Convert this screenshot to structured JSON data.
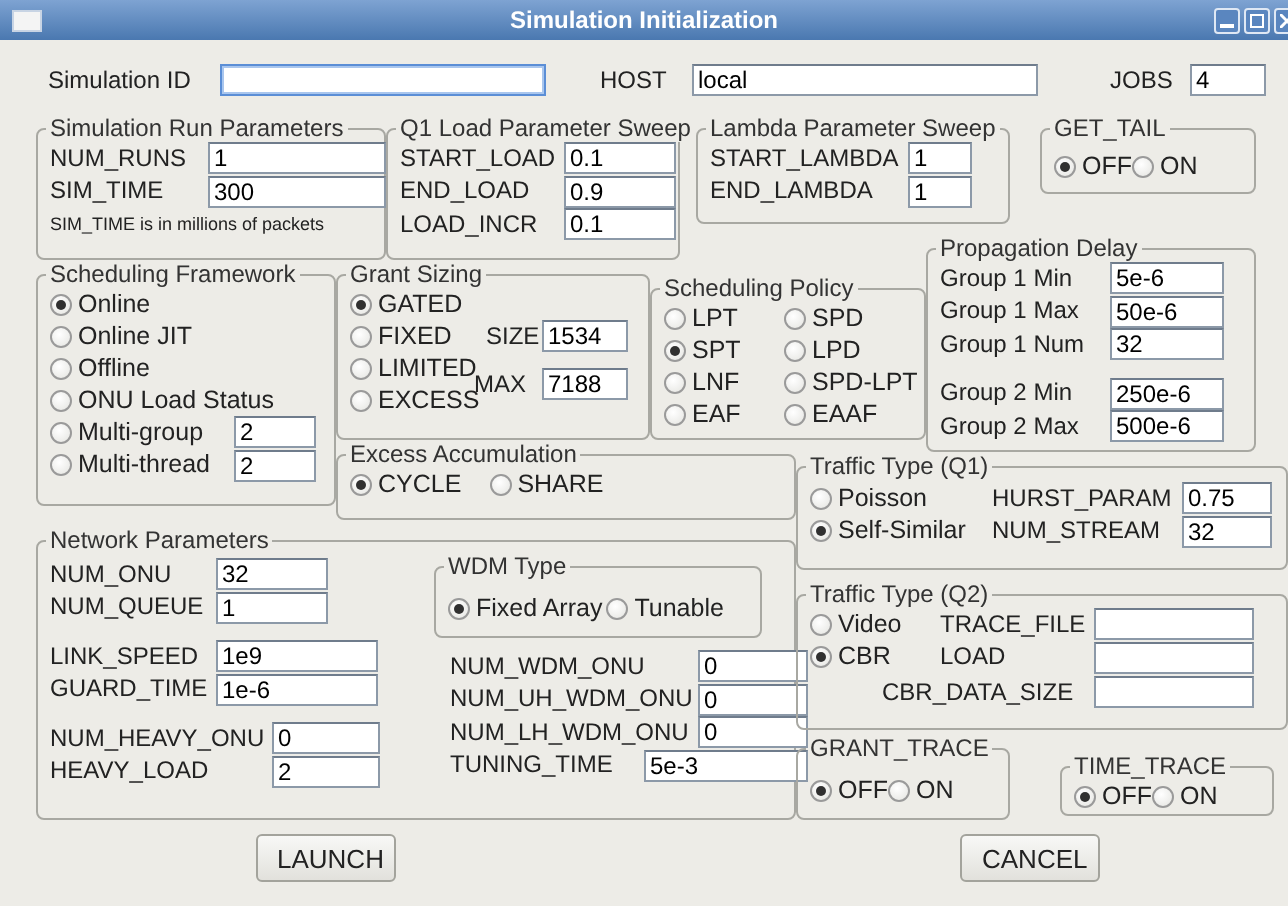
{
  "window": {
    "title": "Simulation Initialization"
  },
  "header": [
    {
      "label": "Simulation ID"
    },
    {
      "label": "HOST",
      "value": "local"
    },
    {
      "label": "JOBS",
      "value": "4"
    }
  ],
  "simulation_run_parameters": {
    "title": "Simulation Run Parameters",
    "fields": [
      {
        "label": "NUM_RUNS",
        "value": "1"
      },
      {
        "label": "SIM_TIME",
        "value": "300"
      }
    ],
    "note": "SIM_TIME is in millions of packets"
  },
  "q1_load_parameter_sweep": {
    "title": "Q1 Load Parameter Sweep",
    "fields": [
      {
        "label": "START_LOAD",
        "value": "0.1"
      },
      {
        "label": "END_LOAD",
        "value": "0.9"
      },
      {
        "label": "LOAD_INCR",
        "value": "0.1"
      }
    ]
  },
  "lambda_parameter_sweep": {
    "title": "Lambda Parameter Sweep",
    "fields": [
      {
        "label": "START_LAMBDA",
        "value": "1"
      },
      {
        "label": "END_LAMBDA",
        "value": "1"
      }
    ]
  },
  "get_tail": {
    "title": "GET_TAIL",
    "options": [
      {
        "label": "OFF",
        "selected": true
      },
      {
        "label": "ON",
        "selected": false
      }
    ]
  },
  "scheduling_framework": {
    "title": "Scheduling Framework",
    "options": [
      {
        "label": "Online",
        "selected": true
      },
      {
        "label": "Online JIT",
        "selected": false
      },
      {
        "label": "Offline",
        "selected": false
      },
      {
        "label": "ONU Load Status",
        "selected": false
      },
      {
        "label": "Multi-group",
        "selected": false,
        "value": "2"
      },
      {
        "label": "Multi-thread",
        "selected": false,
        "value": "2"
      }
    ]
  },
  "grant_sizing": {
    "title": "Grant Sizing",
    "options": [
      {
        "label": "GATED",
        "selected": true
      },
      {
        "label": "FIXED",
        "selected": false
      },
      {
        "label": "LIMITED",
        "selected": false
      },
      {
        "label": "EXCESS",
        "selected": false
      }
    ],
    "fields": [
      {
        "label": "SIZE",
        "value": "1534"
      },
      {
        "label": "MAX",
        "value": "7188"
      }
    ]
  },
  "scheduling_policy": {
    "title": "Scheduling Policy",
    "options": [
      {
        "label": "LPT",
        "selected": false
      },
      {
        "label": "SPD",
        "selected": false
      },
      {
        "label": "SPT",
        "selected": true
      },
      {
        "label": "LPD",
        "selected": false
      },
      {
        "label": "LNF",
        "selected": false
      },
      {
        "label": "SPD-LPT",
        "selected": false
      },
      {
        "label": "EAF",
        "selected": false
      },
      {
        "label": "EAAF",
        "selected": false
      }
    ]
  },
  "propagation_delay": {
    "title": "Propagation Delay",
    "field_sets": [
      [
        {
          "label": "Group 1 Min",
          "value": "5e-6"
        },
        {
          "label": "Group 1 Max",
          "value": "50e-6"
        },
        {
          "label": "Group 1 Num",
          "value": "32"
        }
      ],
      [
        {
          "label": "Group 2 Min",
          "value": "250e-6"
        },
        {
          "label": "Group 2 Max",
          "value": "500e-6"
        }
      ]
    ]
  },
  "excess_accumulation": {
    "title": "Excess Accumulation",
    "options": [
      {
        "label": "CYCLE",
        "selected": true
      },
      {
        "label": "SHARE",
        "selected": false
      }
    ]
  },
  "traffic_type_q1": {
    "title": "Traffic Type (Q1)",
    "options": [
      {
        "label": "Poisson",
        "selected": false
      },
      {
        "label": "Self-Similar",
        "selected": true
      }
    ],
    "fields": [
      {
        "label": "HURST_PARAM",
        "value": "0.75"
      },
      {
        "label": "NUM_STREAM",
        "value": "32"
      }
    ]
  },
  "network_parameters": {
    "title": "Network Parameters",
    "field_sets": [
      [
        {
          "label": "NUM_ONU",
          "value": "32"
        },
        {
          "label": "NUM_QUEUE",
          "value": "1"
        }
      ],
      [
        {
          "label": "LINK_SPEED",
          "value": "1e9"
        },
        {
          "label": "GUARD_TIME",
          "value": "1e-6"
        }
      ],
      [
        {
          "label": "NUM_HEAVY_ONU",
          "value": "0"
        },
        {
          "label": "HEAVY_LOAD",
          "value": "2"
        }
      ]
    ],
    "wdm_type": {
      "title": "WDM Type",
      "options": [
        {
          "label": "Fixed Array",
          "selected": true
        },
        {
          "label": "Tunable",
          "selected": false
        }
      ]
    },
    "wdm_fields": [
      {
        "label": "NUM_WDM_ONU",
        "value": "0"
      },
      {
        "label": "NUM_UH_WDM_ONU",
        "value": "0"
      },
      {
        "label": "NUM_LH_WDM_ONU",
        "value": "0"
      },
      {
        "label": "TUNING_TIME",
        "value": "5e-3"
      }
    ]
  },
  "traffic_type_q2": {
    "title": "Traffic Type (Q2)",
    "options": [
      {
        "label": "Video",
        "selected": false
      },
      {
        "label": "CBR",
        "selected": true
      }
    ],
    "fields": [
      {
        "label": "TRACE_FILE"
      },
      {
        "label": "LOAD"
      },
      {
        "label": "CBR_DATA_SIZE"
      }
    ]
  },
  "grant_trace": {
    "title": "GRANT_TRACE",
    "options": [
      {
        "label": "OFF",
        "selected": true
      },
      {
        "label": "ON",
        "selected": false
      }
    ]
  },
  "time_trace": {
    "title": "TIME_TRACE",
    "options": [
      {
        "label": "OFF",
        "selected": true
      },
      {
        "label": "ON",
        "selected": false
      }
    ]
  },
  "buttons": [
    {
      "label": "LAUNCH"
    },
    {
      "label": "CANCEL"
    }
  ]
}
